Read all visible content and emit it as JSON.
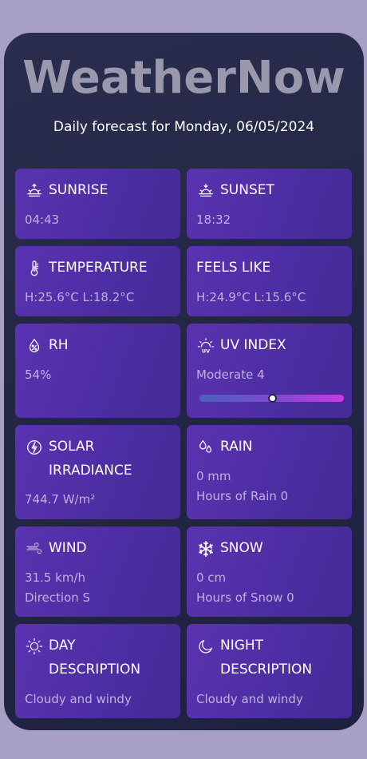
{
  "app": {
    "title": "WeatherNow",
    "subtitle": "Daily forecast for Monday, 06/05/2024"
  },
  "cards": {
    "sunrise": {
      "label": "SUNRISE",
      "value": "04:43",
      "icon": "sunrise-icon"
    },
    "sunset": {
      "label": "SUNSET",
      "value": "18:32",
      "icon": "sunset-icon"
    },
    "temperature": {
      "label": "TEMPERATURE",
      "value": "H:25.6°C L:18.2°C",
      "icon": "thermometer-icon"
    },
    "feels_like": {
      "label": "FEELS LIKE",
      "value": "H:24.9°C L:15.6°C"
    },
    "rh": {
      "label": "RH",
      "value": "54%",
      "icon": "humidity-icon"
    },
    "uv_index": {
      "label": "UV INDEX",
      "value": "Moderate 4",
      "level": 0.5,
      "icon": "uv-icon"
    },
    "solar": {
      "label_line1": "SOLAR",
      "label_line2": "IRRADIANCE",
      "value": "744.7 W/m²",
      "icon": "lightning-icon"
    },
    "rain": {
      "label": "RAIN",
      "value": "0 mm",
      "detail": "Hours of Rain 0",
      "icon": "raindrops-icon"
    },
    "wind": {
      "label": "WIND",
      "value": "31.5 km/h",
      "detail": "Direction S",
      "icon": "wind-icon"
    },
    "snow": {
      "label": "SNOW",
      "value": "0 cm",
      "detail": "Hours of Snow 0",
      "icon": "snowflake-icon"
    },
    "day": {
      "label_line1": "DAY",
      "label_line2": "DESCRIPTION",
      "value": "Cloudy and windy",
      "icon": "sun-icon"
    },
    "night": {
      "label_line1": "NIGHT",
      "label_line2": "DESCRIPTION",
      "value": "Cloudy and windy",
      "icon": "moon-icon"
    }
  },
  "colors": {
    "page_background": "#a79fc4",
    "app_background": "#252944",
    "card": "#5030a8",
    "title": "#9a98ad",
    "muted_text": "#bdb2dc"
  }
}
